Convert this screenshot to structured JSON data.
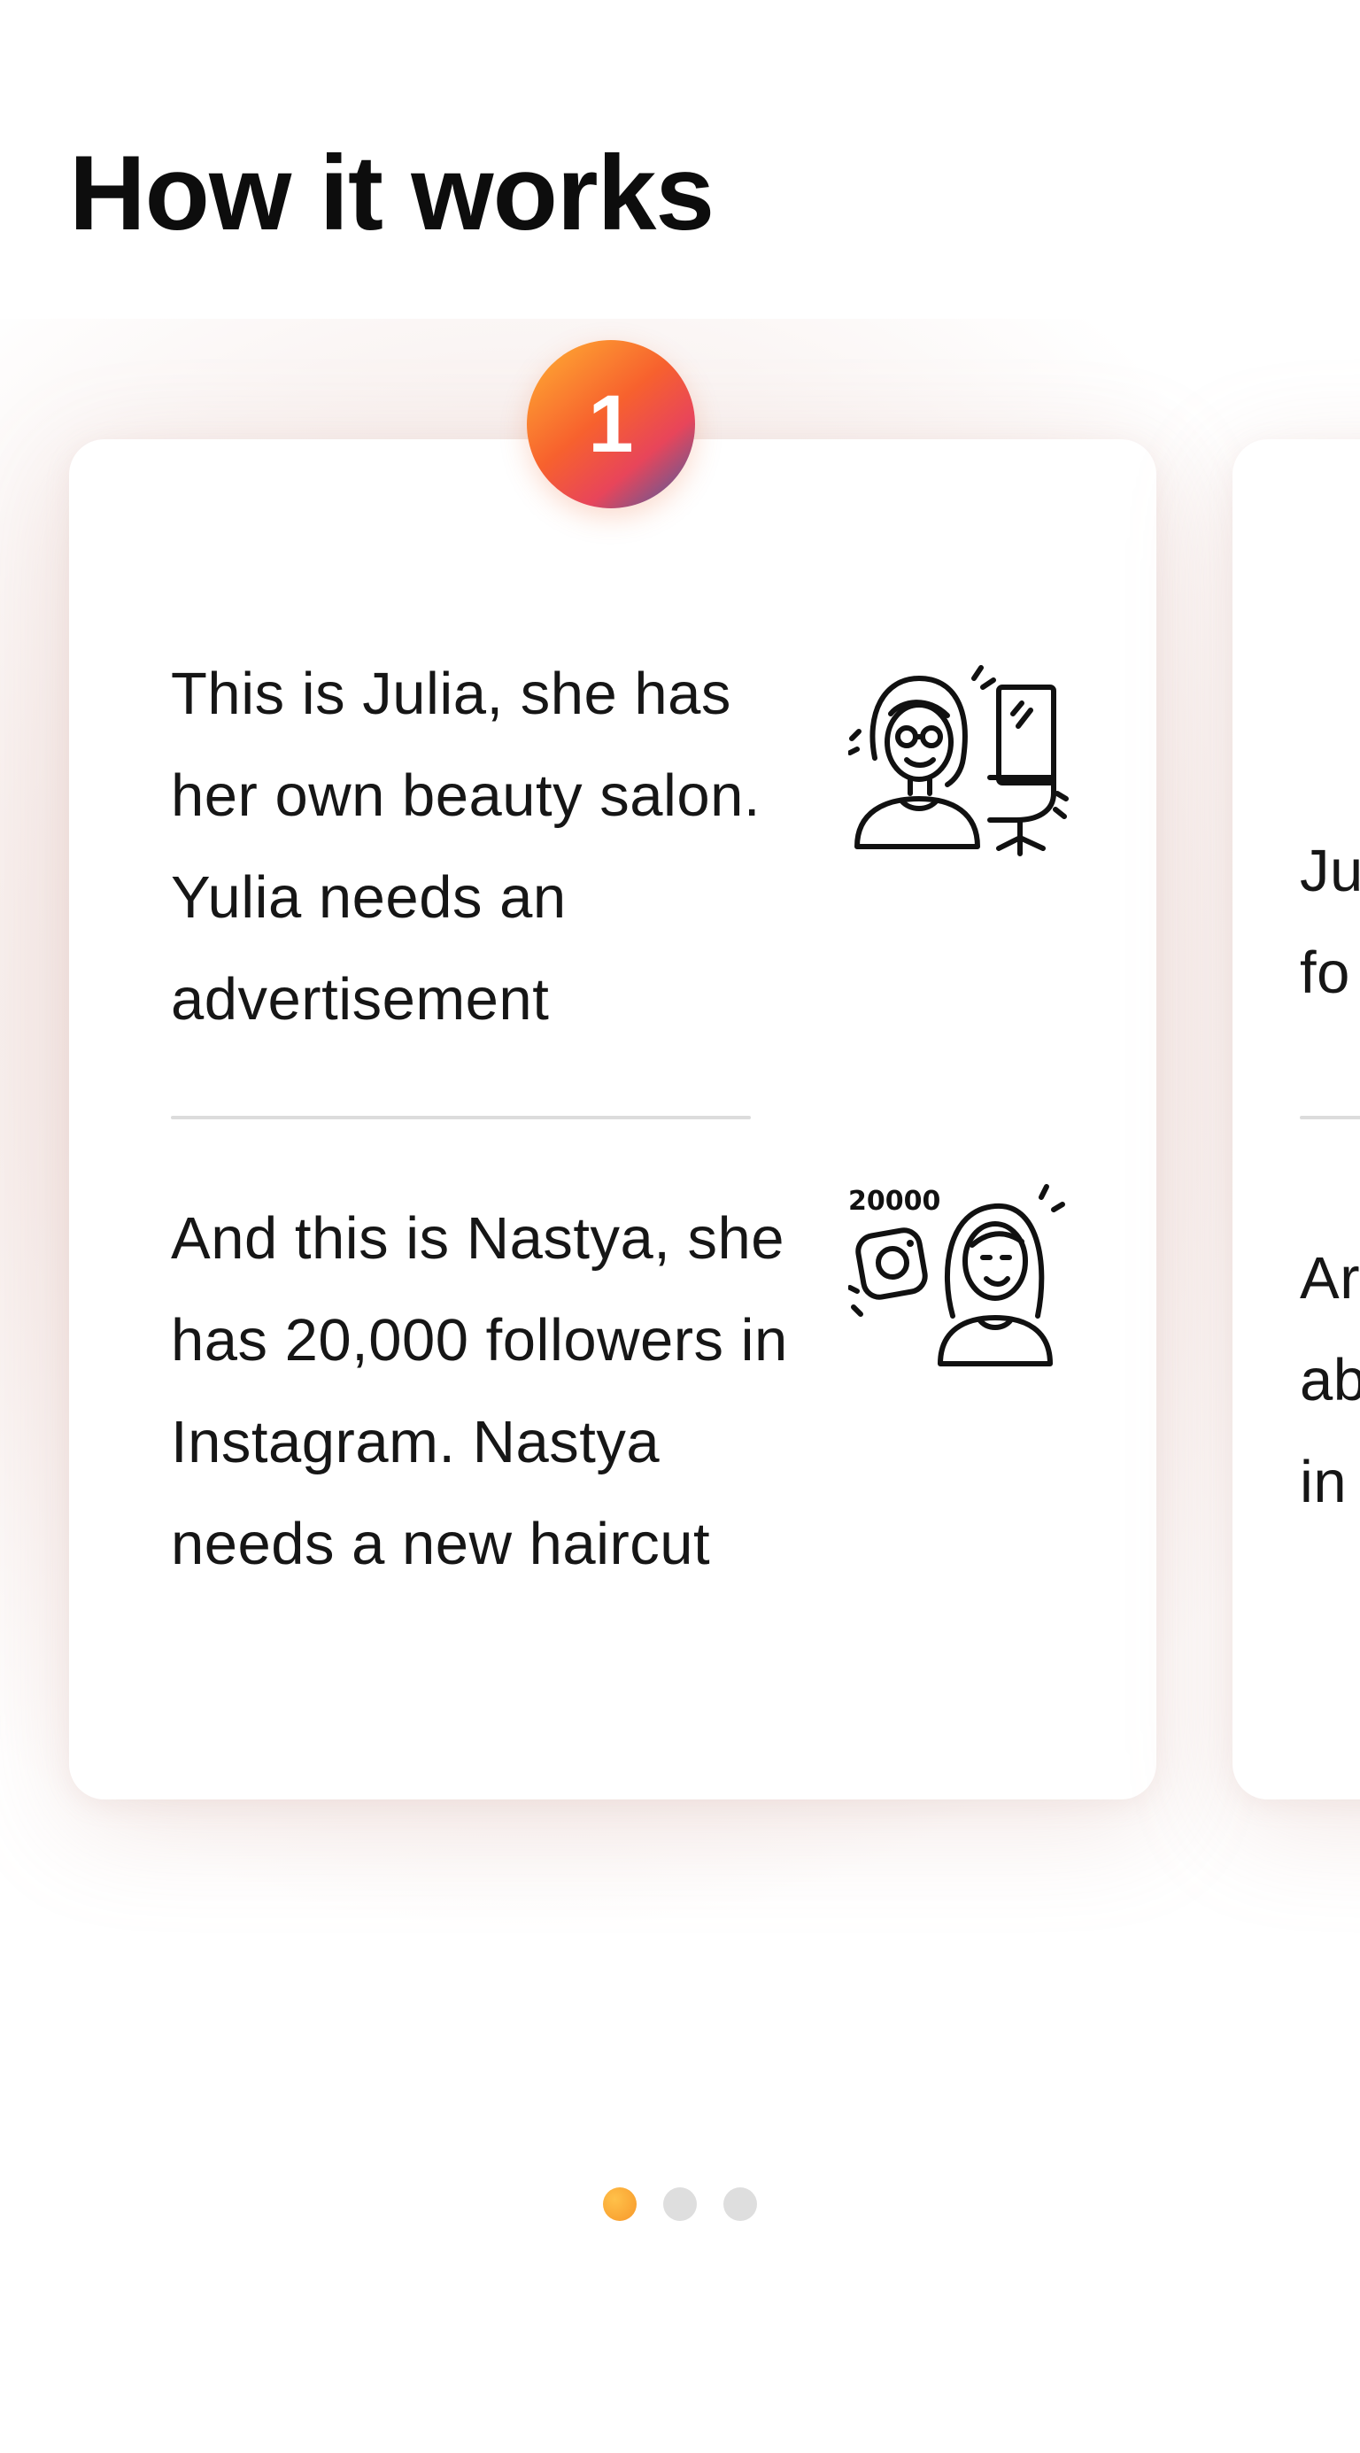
{
  "page": {
    "title": "How it works"
  },
  "carousel": {
    "cards": [
      {
        "step": "1",
        "stories": [
          {
            "text": "This is Julia, she has her own beauty salon. Yulia needs an advertisement",
            "illustration": "woman-salon-chair-icon"
          },
          {
            "text": "And this is Nastya, she has 20,000 followers in Instagram. Nastya needs a new haircut",
            "illustration": "influencer-instagram-icon",
            "illustration_text": "20000"
          }
        ]
      },
      {
        "stories": [
          {
            "lines": [
              "Ju",
              "fo"
            ]
          },
          {
            "lines": [
              "Ar",
              "ab",
              "in"
            ]
          }
        ]
      }
    ],
    "pagination": {
      "count": 3,
      "active_index": 0
    }
  },
  "colors": {
    "accent_start": "#ffb233",
    "accent_mid": "#f7612e",
    "accent_end": "#3d5fa8",
    "dot_inactive": "#dedede",
    "divider": "#dcdcdc"
  }
}
